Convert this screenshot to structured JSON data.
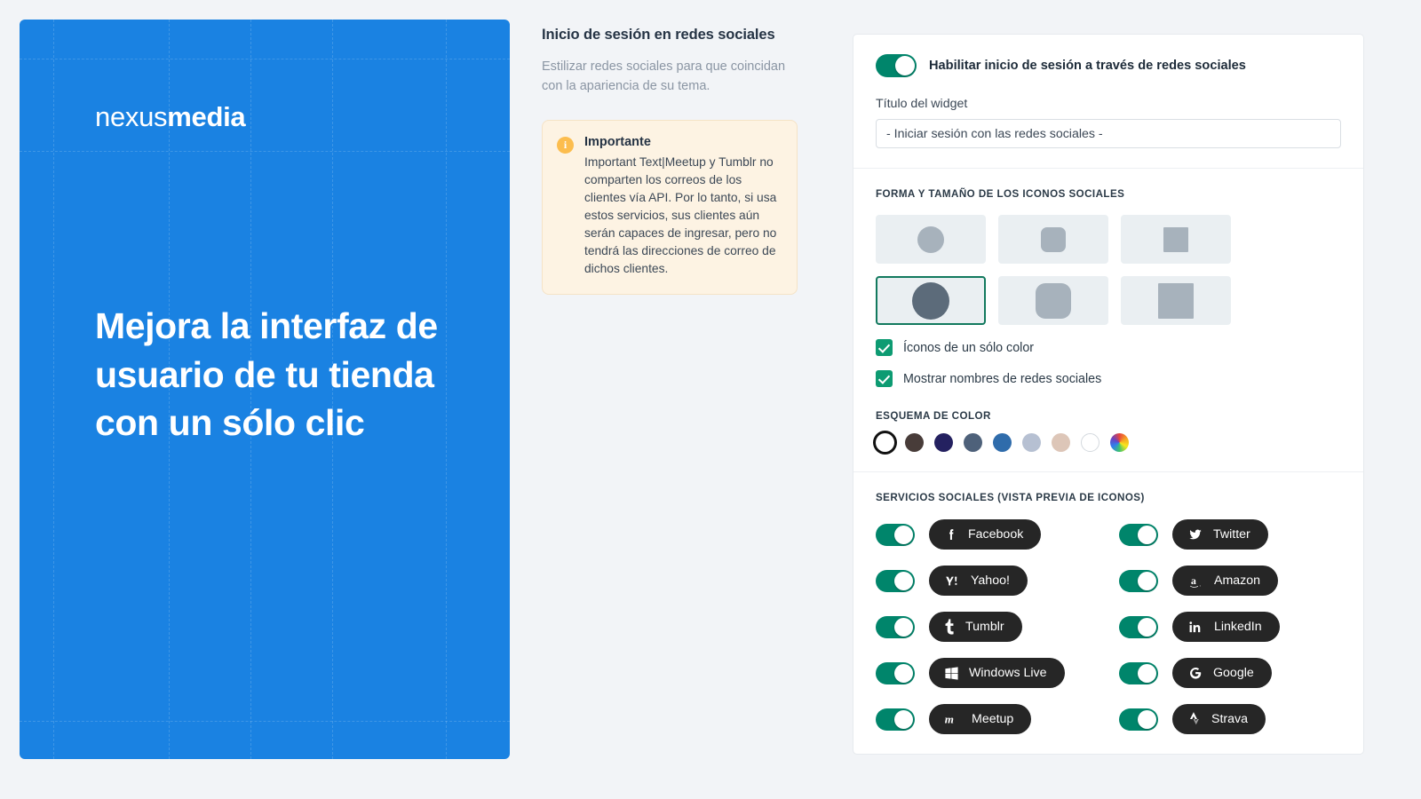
{
  "preview": {
    "logo_thin": "nexus",
    "logo_bold": "media",
    "headline": "Mejora la interfaz de usuario de tu tienda con un sólo clic",
    "background_color": "#1a82e2"
  },
  "intro": {
    "title": "Inicio de sesión en redes sociales",
    "subtitle": "Estilizar redes sociales para que coincidan con la apariencia de su tema.",
    "notice": {
      "icon": "info-icon",
      "title": "Importante",
      "text": "Important Text|Meetup y Tumblr no comparten los correos de los clientes vía API. Por lo tanto, si usa estos servicios, sus clientes aún serán capaces de ingresar, pero no tendrá las direcciones de correo de dichos clientes."
    }
  },
  "settings": {
    "enable_toggle": {
      "label": "Habilitar inicio de sesión a través de redes sociales",
      "state": "on"
    },
    "widget_title": {
      "label": "Título del widget",
      "value": "- Iniciar sesión con las redes sociales -",
      "placeholder": "- Iniciar sesión con las redes sociales -"
    },
    "shape_section": {
      "heading": "Forma y tamaño de los iconos sociales",
      "tiles": [
        {
          "shape": "circle",
          "size": "small",
          "selected": false
        },
        {
          "shape": "rounded",
          "size": "small",
          "selected": false
        },
        {
          "shape": "square",
          "size": "small",
          "selected": false
        },
        {
          "shape": "circle",
          "size": "large",
          "selected": true
        },
        {
          "shape": "rounded",
          "size": "large",
          "selected": false
        },
        {
          "shape": "square",
          "size": "large",
          "selected": false
        }
      ]
    },
    "checkboxes": [
      {
        "label": "Íconos de un sólo color",
        "checked": true
      },
      {
        "label": "Mostrar nombres de redes sociales",
        "checked": true
      }
    ],
    "color_scheme": {
      "heading": "Esquema de color",
      "swatches": [
        {
          "name": "white-selected",
          "color": "#ffffff",
          "selected": true
        },
        {
          "name": "dark-brown",
          "color": "#483c39",
          "selected": false
        },
        {
          "name": "navy",
          "color": "#242160",
          "selected": false
        },
        {
          "name": "slate-blue",
          "color": "#4e617a",
          "selected": false
        },
        {
          "name": "steel-blue",
          "color": "#2f6cab",
          "selected": false
        },
        {
          "name": "light-blue-gray",
          "color": "#b6c0d2",
          "selected": false
        },
        {
          "name": "beige",
          "color": "#ddc6b8",
          "selected": false
        },
        {
          "name": "white",
          "color": "#ffffff",
          "selected": false
        },
        {
          "name": "custom-rainbow",
          "color": "rainbow",
          "selected": false
        }
      ]
    },
    "services_section": {
      "heading": "Servicios sociales (vista previa de iconos)",
      "services": [
        {
          "name": "Facebook",
          "icon": "facebook-icon",
          "enabled": true,
          "column": "left"
        },
        {
          "name": "Twitter",
          "icon": "twitter-icon",
          "enabled": true,
          "column": "right"
        },
        {
          "name": "Yahoo!",
          "icon": "yahoo-icon",
          "enabled": true,
          "column": "left"
        },
        {
          "name": "Amazon",
          "icon": "amazon-icon",
          "enabled": true,
          "column": "right"
        },
        {
          "name": "Tumblr",
          "icon": "tumblr-icon",
          "enabled": true,
          "column": "left"
        },
        {
          "name": "LinkedIn",
          "icon": "linkedin-icon",
          "enabled": true,
          "column": "right"
        },
        {
          "name": "Windows Live",
          "icon": "windows-live-icon",
          "enabled": true,
          "column": "left"
        },
        {
          "name": "Google",
          "icon": "google-icon",
          "enabled": true,
          "column": "right"
        },
        {
          "name": "Meetup",
          "icon": "meetup-icon",
          "enabled": true,
          "column": "left"
        },
        {
          "name": "Strava",
          "icon": "strava-icon",
          "enabled": true,
          "column": "right"
        }
      ]
    }
  },
  "colors": {
    "accent_green": "#00856b",
    "checkbox_green": "#0d9b72",
    "selected_border": "#12795e",
    "chip_dark": "#262626",
    "page_background": "#f2f4f7",
    "notice_background": "#fdf3e3"
  }
}
